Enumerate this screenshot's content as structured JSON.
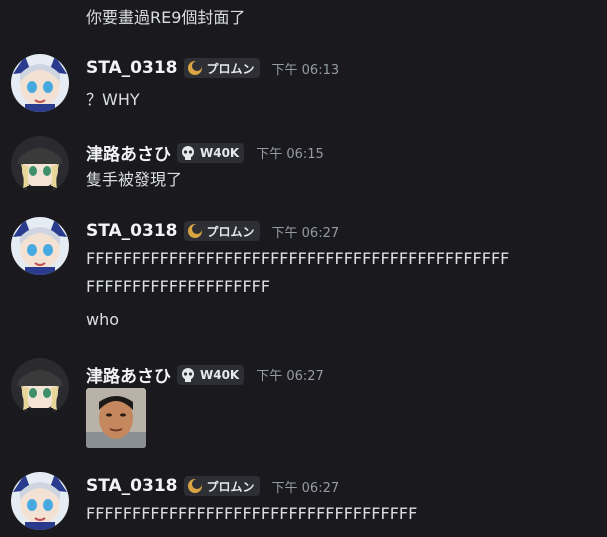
{
  "messages": [
    {
      "lines": [
        "你要畫過RE9個封面了"
      ]
    },
    {
      "user": "STA_0318",
      "tag": "プロムン",
      "tag_icon": "moon-icon",
      "time": "下午 06:13",
      "lines": [
        "？WHY"
      ]
    },
    {
      "user": "津路あさひ",
      "tag": "W40K",
      "tag_icon": "skull-icon",
      "time": "下午 06:15",
      "lines": [
        "隻手被發現了"
      ]
    },
    {
      "user": "STA_0318",
      "tag": "プロムン",
      "tag_icon": "moon-icon",
      "time": "下午 06:27",
      "lines": [
        "FFFFFFFFFFFFFFFFFFFFFFFFFFFFFFFFFFFFFFFFFFFFFF",
        "FFFFFFFFFFFFFFFFFFFF",
        "who"
      ]
    },
    {
      "user": "津路あさひ",
      "tag": "W40K",
      "tag_icon": "skull-icon",
      "time": "下午 06:27",
      "attachment": "photo-of-man"
    },
    {
      "user": "STA_0318",
      "tag": "プロムン",
      "tag_icon": "moon-icon",
      "time": "下午 06:27",
      "lines": [
        "FFFFFFFFFFFFFFFFFFFFFFFFFFFFFFFFFFFF"
      ]
    }
  ],
  "colors": {
    "background": "#1a1a1e",
    "text": "#dbdee1",
    "username": "#f2f3f5",
    "timestamp": "#949ba4",
    "tag_bg": "#2e2f35"
  }
}
